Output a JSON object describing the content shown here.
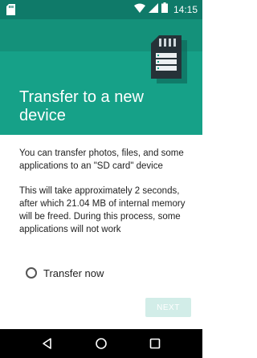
{
  "status_bar": {
    "time": "14:15",
    "background": "#0f7a69"
  },
  "hero": {
    "title": "Transfer to a new device",
    "background": "#16a188",
    "illustration": "sd-card-icon"
  },
  "content": {
    "paragraph1": "You can transfer photos, files, and some applications to an \"SD card\" device",
    "paragraph2": "This will take approximately 2 seconds, after which 21.04 MB of internal memory will be freed. During this process, some applications will not work"
  },
  "options": {
    "transfer_now_label": "Transfer now",
    "transfer_now_selected": false
  },
  "actions": {
    "next_label": "NEXT",
    "next_enabled": false
  },
  "nav": {
    "back_icon": "back-triangle-icon",
    "home_icon": "home-circle-icon",
    "recents_icon": "recents-square-icon"
  }
}
